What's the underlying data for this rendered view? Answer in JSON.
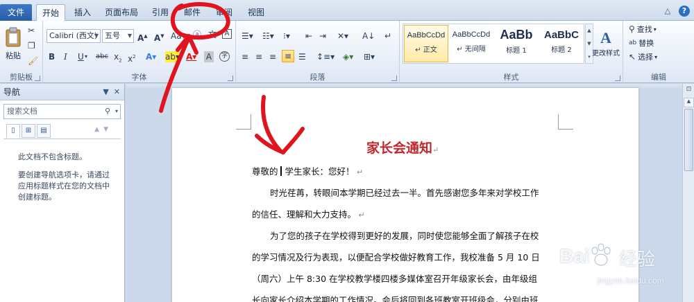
{
  "tabs": {
    "file": "文件",
    "items": [
      {
        "label": "开始",
        "active": true
      },
      {
        "label": "插入"
      },
      {
        "label": "页面布局"
      },
      {
        "label": "引用"
      },
      {
        "label": "邮件"
      },
      {
        "label": "审阅"
      },
      {
        "label": "视图"
      }
    ]
  },
  "ribbon": {
    "clipboard": {
      "paste": "粘贴",
      "label": "剪贴板"
    },
    "font": {
      "family": "Calibri (西文)",
      "size": "五号",
      "label": "字体"
    },
    "paragraph": {
      "label": "段落"
    },
    "styles": {
      "label": "样式",
      "tiles": [
        {
          "sample": "AaBbCcDd",
          "name": "↵ 正文"
        },
        {
          "sample": "AaBbCcDd",
          "name": "↵ 无间隔"
        },
        {
          "sample": "AaBb",
          "name": "标题 1"
        },
        {
          "sample": "AaBbC",
          "name": "标题 2"
        }
      ],
      "change": "更改样式"
    },
    "editing": {
      "find": "查找",
      "replace": "替换",
      "select": "选择",
      "label": "编辑"
    }
  },
  "nav": {
    "title": "导航",
    "search_placeholder": "搜索文档",
    "msg1": "此文档不包含标题。",
    "msg2": "要创建导航选项卡，请通过应用标题样式在您的文档中创建标题。"
  },
  "doc": {
    "title": "家长会通知",
    "salutation_a": "尊敬的",
    "salutation_b": "学生家长：您好！",
    "p1_line1": "时光荏苒，转眼间本学期已经过去一半。首先感谢您多年来对学校工作",
    "p1_line2": "的信任、理解和大力支持。",
    "p2_line1": "为了您的孩子在学校得到更好的发展，同时使您能够全面了解孩子在校",
    "p2_line2": "的学习情况及行为表现，以便配合学校做好教育工作，我校准备 5 月 10 日",
    "p2_line3": "（周六）上午 8:30 在学校教学楼四楼多媒体室召开年级家长会，由年级组",
    "p2_line4": "长向家长介绍本学期的工作情况。会后将回到各班教室开班级会，分别由班"
  },
  "watermark": {
    "brand": "Bai",
    "brand_cn": "经验",
    "url": "jingyan.baidu.com"
  },
  "colors": {
    "annotation": "#e0141e",
    "title_red": "#c0282d",
    "accent": "#2a5ba6"
  }
}
